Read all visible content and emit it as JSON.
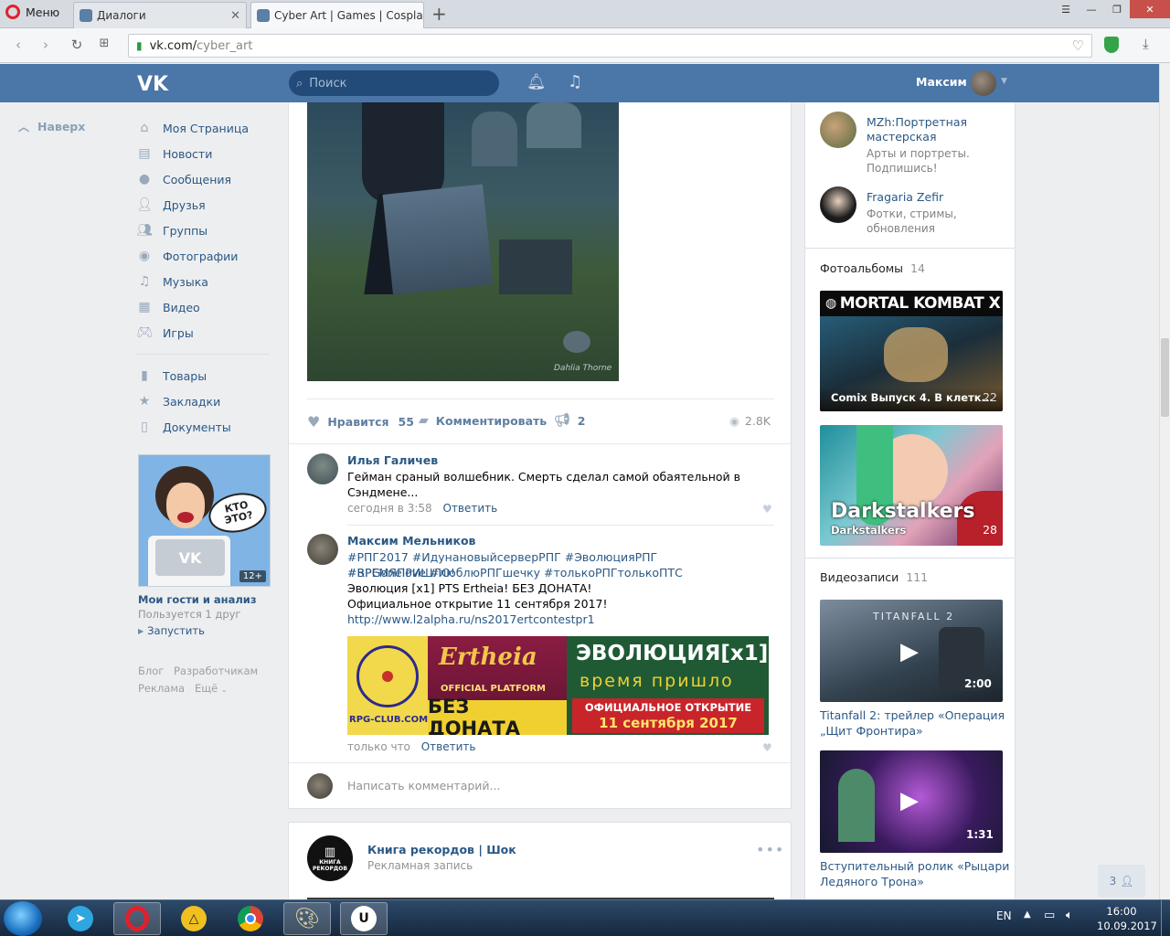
{
  "browser": {
    "menu_label": "Меню",
    "tabs": [
      {
        "title": "Диалоги",
        "active": false
      },
      {
        "title": "Cyber Art | Games | Cospla",
        "active": true
      }
    ],
    "new_tab": "+",
    "url_domain": "vk.com/",
    "url_path": "cyber_art"
  },
  "header": {
    "search_placeholder": "Поиск",
    "user_name": "Максим",
    "brand_color": "#4a76a8"
  },
  "back_to_top": "Наверх",
  "sidebar": {
    "items": [
      {
        "label": "Моя Страница",
        "icon": "home-icon"
      },
      {
        "label": "Новости",
        "icon": "news-icon"
      },
      {
        "label": "Сообщения",
        "icon": "messages-icon"
      },
      {
        "label": "Друзья",
        "icon": "friends-icon"
      },
      {
        "label": "Группы",
        "icon": "groups-icon"
      },
      {
        "label": "Фотографии",
        "icon": "camera-icon"
      },
      {
        "label": "Музыка",
        "icon": "music-icon"
      },
      {
        "label": "Видео",
        "icon": "video-icon"
      },
      {
        "label": "Игры",
        "icon": "gamepad-icon"
      },
      {
        "label": "Товары",
        "icon": "bag-icon"
      },
      {
        "label": "Закладки",
        "icon": "star-icon"
      },
      {
        "label": "Документы",
        "icon": "document-icon"
      }
    ],
    "ad": {
      "bubble": "КТО ЭТО?",
      "age": "12+",
      "title": "Мои гости и анализ",
      "subtitle": "Пользуется 1 друг",
      "launch": "Запустить"
    },
    "footer": [
      "Блог",
      "Разработчикам",
      "Реклама",
      "Ещё"
    ]
  },
  "post": {
    "watermark": "Dahlia Thorne",
    "actions": {
      "like_label": "Нравится",
      "like_count": "55",
      "comment_label": "Комментировать",
      "share_count": "2",
      "views": "2.8K"
    },
    "comments": [
      {
        "name": "Илья Галичев",
        "text": "Гейман сраный волшебник. Смерть сделал самой обаятельной в Сэндмене...",
        "time": "сегодня в 3:58",
        "reply": "Ответить"
      },
      {
        "name": "Максим Мельников",
        "hashtags1": "#РПГ2017 #ИдунановыйсерверРПГ #ЭволюцияРПГ #ВРЕМЯПРИШЛО!",
        "hashtags2": "#RPGonelove #люблюРПГшечку #толькоРПГтолькоПТС",
        "line3": "Эволюция [x1] PTS Ertheia! БЕЗ ДОНАТА!",
        "line4": "Официальное открытие 11 сентября 2017!",
        "link": "http://www.l2alpha.ru/ns2017ertcontestpr1",
        "time": "только что",
        "reply": "Ответить",
        "banner": {
          "site": "RPG-CLUB.COM",
          "logo": "Ertheia",
          "platform": "OFFICIAL PLATFORM",
          "nodonat": "БЕЗ ДОНАТА",
          "evo": "ЭВОЛЮЦИЯ[x1]",
          "time": "время пришло",
          "open1": "ОФИЦИАЛЬНОЕ ОТКРЫТИЕ",
          "open2": "11 сентября 2017"
        }
      }
    ],
    "write_placeholder": "Написать комментарий..."
  },
  "ad_post": {
    "name": "Книга рекордов | Шок",
    "subtitle": "Рекламная запись",
    "avatar_text": "КНИГА РЕКОРДОВ"
  },
  "right": {
    "contacts": [
      {
        "name1": "MZh:Портретная",
        "name2": "мастерская",
        "desc1": "Арты и портреты.",
        "desc2": "Подпишись!"
      },
      {
        "name1": "Fragaria Zefir",
        "name2": "",
        "desc1": "Фотки, стримы,",
        "desc2": "обновления"
      }
    ],
    "albums_title": "Фотоальбомы",
    "albums_count": "14",
    "albums": [
      {
        "banner": "MORTAL KOMBAT X",
        "caption": "Comix Выпуск 4. В клетк...",
        "count": "22"
      },
      {
        "banner": "Darkstalkers",
        "caption": "Darkstalkers",
        "count": "28"
      }
    ],
    "videos_title": "Видеозаписи",
    "videos_count": "111",
    "videos": [
      {
        "overlay": "TITANFALL 2",
        "duration": "2:00",
        "title1": "Titanfall 2: трейлер «Операция",
        "title2": "„Щит Фронтира»"
      },
      {
        "overlay": "",
        "duration": "1:31",
        "title1": "Вступительный ролик «Рыцари",
        "title2": "Ледяного Трона»"
      }
    ],
    "friends_online": "3"
  },
  "taskbar": {
    "lang": "EN",
    "time": "16:00",
    "date": "10.09.2017"
  }
}
